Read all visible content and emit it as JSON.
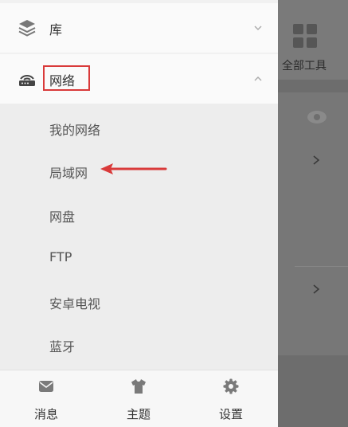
{
  "background": {
    "tools_label": "全部工具"
  },
  "menu": {
    "library_label": "库",
    "network_label": "网络",
    "network_items": [
      "我的网络",
      "局域网",
      "网盘",
      "FTP",
      "安卓电视",
      "蓝牙"
    ]
  },
  "bottom_bar": {
    "messages_label": "消息",
    "theme_label": "主题",
    "settings_label": "设置"
  },
  "colors": {
    "annotation": "#d93a3a",
    "drawer_bg": "#f1f1f1",
    "overlay": "#6d6d6d"
  }
}
